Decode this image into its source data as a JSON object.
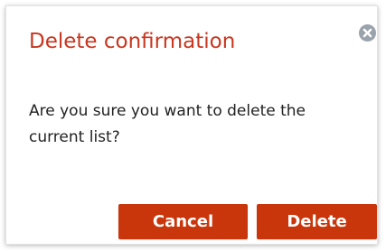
{
  "dialog": {
    "title": "Delete confirmation",
    "message": "Are you sure you want to delete the current list?",
    "close_icon": "close-circle-icon",
    "buttons": {
      "cancel_label": "Cancel",
      "delete_label": "Delete"
    }
  },
  "colors": {
    "accent": "#c9360c",
    "title": "#c8361f",
    "close_icon": "#9aa2ab"
  }
}
